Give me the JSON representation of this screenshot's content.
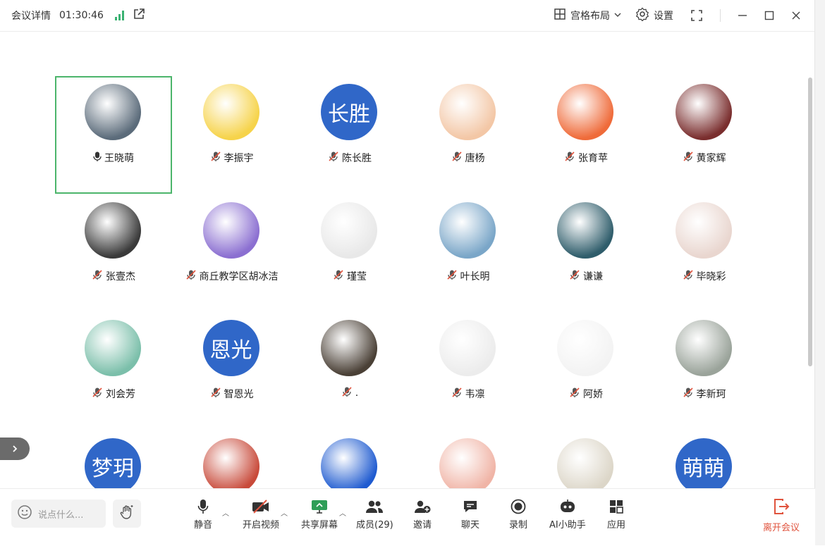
{
  "titlebar": {
    "meeting_details": "会议详情",
    "timer": "01:30:46",
    "layout_label": "宫格布局",
    "settings_label": "设置"
  },
  "participants": [
    {
      "name": "王晓萌",
      "mic": "on",
      "avatar_text": "",
      "active": true
    },
    {
      "name": "李振宇",
      "mic": "muted",
      "avatar_text": ""
    },
    {
      "name": "陈长胜",
      "mic": "muted",
      "avatar_text": "长胜"
    },
    {
      "name": "唐杨",
      "mic": "muted",
      "avatar_text": ""
    },
    {
      "name": "张育苹",
      "mic": "muted",
      "avatar_text": ""
    },
    {
      "name": "黄家辉",
      "mic": "muted",
      "avatar_text": ""
    },
    {
      "name": "张壹杰",
      "mic": "muted",
      "avatar_text": ""
    },
    {
      "name": "商丘教学区胡冰洁",
      "mic": "muted",
      "avatar_text": ""
    },
    {
      "name": "瑾莹",
      "mic": "muted",
      "avatar_text": ""
    },
    {
      "name": "叶长明",
      "mic": "muted",
      "avatar_text": ""
    },
    {
      "name": "谦谦",
      "mic": "muted",
      "avatar_text": ""
    },
    {
      "name": "毕晓彩",
      "mic": "muted",
      "avatar_text": ""
    },
    {
      "name": "刘会芳",
      "mic": "muted",
      "avatar_text": ""
    },
    {
      "name": "智恩光",
      "mic": "muted",
      "avatar_text": "恩光"
    },
    {
      "name": ".",
      "mic": "muted",
      "avatar_text": ""
    },
    {
      "name": "韦凛",
      "mic": "muted",
      "avatar_text": ""
    },
    {
      "name": "阿娇",
      "mic": "muted",
      "avatar_text": ""
    },
    {
      "name": "李新珂",
      "mic": "muted",
      "avatar_text": ""
    },
    {
      "name": "",
      "mic": "muted",
      "avatar_text": "梦玥"
    },
    {
      "name": "",
      "mic": "muted",
      "avatar_text": ""
    },
    {
      "name": "",
      "mic": "muted",
      "avatar_text": ""
    },
    {
      "name": "",
      "mic": "muted",
      "avatar_text": ""
    },
    {
      "name": "",
      "mic": "muted",
      "avatar_text": ""
    },
    {
      "name": "",
      "mic": "muted",
      "avatar_text": "萌萌"
    }
  ],
  "toolbar": {
    "chat_placeholder": "说点什么...",
    "mute": "静音",
    "video": "开启视频",
    "share": "共享屏幕",
    "members": "成员(29)",
    "invite": "邀请",
    "chat": "聊天",
    "record": "录制",
    "ai": "AI小助手",
    "apps": "应用",
    "leave": "离开会议"
  },
  "colors": {
    "accent_green": "#4cb56b",
    "avatar_blue": "#3067c8",
    "leave_red": "#e0533d",
    "signal_green": "#3bb273"
  }
}
